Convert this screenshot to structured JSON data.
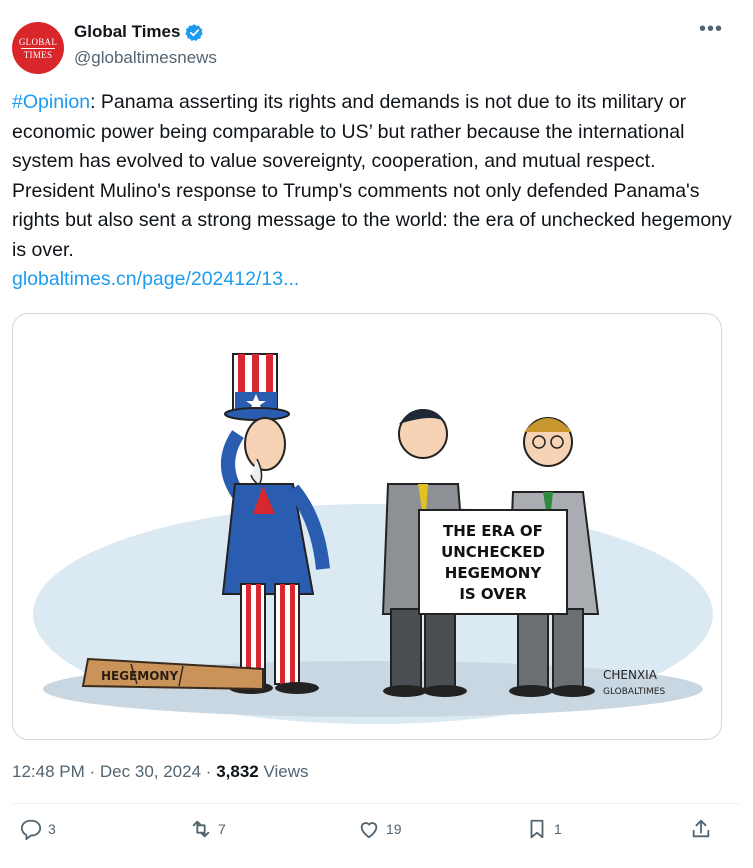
{
  "account": {
    "display_name": "Global Times",
    "handle": "@globaltimesnews",
    "avatar_line1": "GLOBAL",
    "avatar_line2": "TIMES",
    "verified_color": "#1d9bf0"
  },
  "more_icon": "more-horizontal-icon",
  "tweet": {
    "hashtag": "#Opinion",
    "body": ": Panama asserting its rights and demands is not due to its military or economic power being comparable to US’ but rather because the international system has evolved to value sovereignty, cooperation, and mutual respect. President Mulino's response to Trump's comments not only defended Panama's rights but also sent a strong message to the world: the era of unchecked hegemony is over.",
    "link": "globaltimes.cn/page/202412/13..."
  },
  "cartoon": {
    "sign_line1": "THE ERA OF",
    "sign_line2": "UNCHECKED",
    "sign_line3": "HEGEMONY",
    "sign_line4": "IS OVER",
    "club_label": "HEGEMONY",
    "signature_line1": "CHENXIA",
    "signature_line2": "GLOBALTIMES"
  },
  "meta": {
    "time": "12:48 PM",
    "sep1": "·",
    "date": "Dec 30, 2024",
    "sep2": "·",
    "views_count": "3,832",
    "views_label": "Views"
  },
  "actions": {
    "replies": "3",
    "reposts": "7",
    "likes": "19",
    "bookmarks": "1"
  },
  "colors": {
    "link": "#1d9bf0",
    "secondary_text": "#536471",
    "avatar_red": "#d8262b"
  }
}
